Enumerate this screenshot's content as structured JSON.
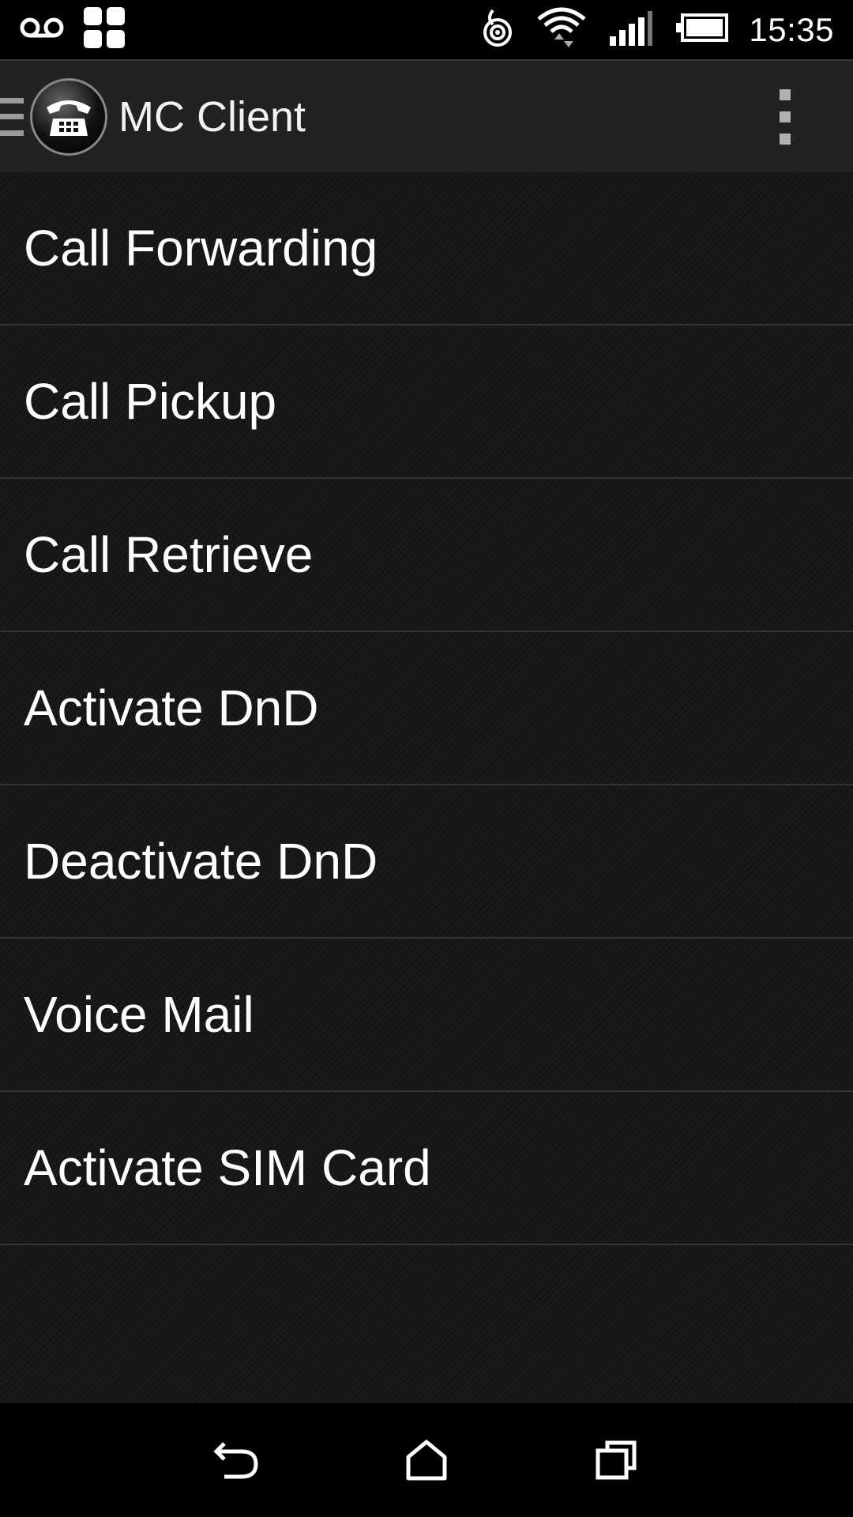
{
  "status_bar": {
    "time": "15:35",
    "icons": [
      "voicemail-icon",
      "apps-grid-icon",
      "sync-icon",
      "wifi-icon",
      "signal-icon",
      "battery-icon"
    ]
  },
  "app_bar": {
    "title": "MC Client",
    "icons": [
      "drawer-icon",
      "app-logo-phone-icon",
      "overflow-menu-icon"
    ]
  },
  "menu": {
    "items": [
      {
        "label": "Call Forwarding"
      },
      {
        "label": "Call Pickup"
      },
      {
        "label": "Call Retrieve"
      },
      {
        "label": "Activate DnD"
      },
      {
        "label": "Deactivate DnD"
      },
      {
        "label": "Voice Mail"
      },
      {
        "label": "Activate SIM Card"
      }
    ]
  },
  "nav_bar": {
    "icons": [
      "back-icon",
      "home-icon",
      "recents-icon"
    ]
  }
}
